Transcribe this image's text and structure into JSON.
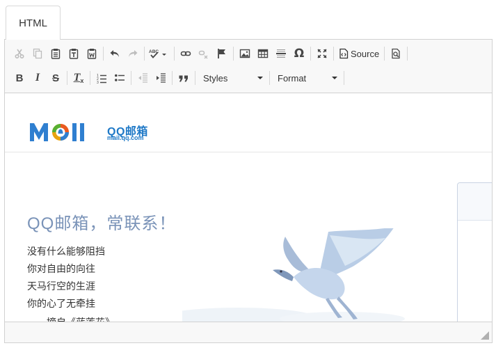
{
  "tabs": [
    {
      "label": "HTML"
    }
  ],
  "toolbar": {
    "row1": {
      "buttons": [
        "cut-icon",
        "copy-icon",
        "paste-icon",
        "paste-text-icon",
        "paste-word-icon",
        "undo-icon",
        "redo-icon",
        "spellcheck-icon",
        "link-icon",
        "unlink-icon",
        "anchor-icon",
        "image-icon",
        "table-icon",
        "horizontal-rule-icon",
        "special-char-icon",
        "maximize-icon",
        "source-icon",
        "preview-icon"
      ],
      "source_label": "Source",
      "omega": "Ω",
      "spell_label": "ABC"
    },
    "row2": {
      "bold_label": "B",
      "italic_label": "I",
      "strike_label": "S",
      "clear_label": "T",
      "styles_label": "Styles",
      "format_label": "Format"
    }
  },
  "content": {
    "logo": {
      "brand": "Mail",
      "cn": "QQ邮箱",
      "url": "mail.qq.com"
    },
    "headline": "QQ邮箱，常联系！",
    "poem": [
      "没有什么能够阻挡",
      "你对自由的向往",
      "天马行空的生涯",
      "你的心了无牵挂"
    ],
    "poem_cut": "——摘自《蓝莲花》"
  },
  "colors": {
    "accent": "#1f79c7",
    "headline": "#7a93b8",
    "toolbar_bg": "#f8f8f8",
    "border": "#d1d1d1"
  }
}
